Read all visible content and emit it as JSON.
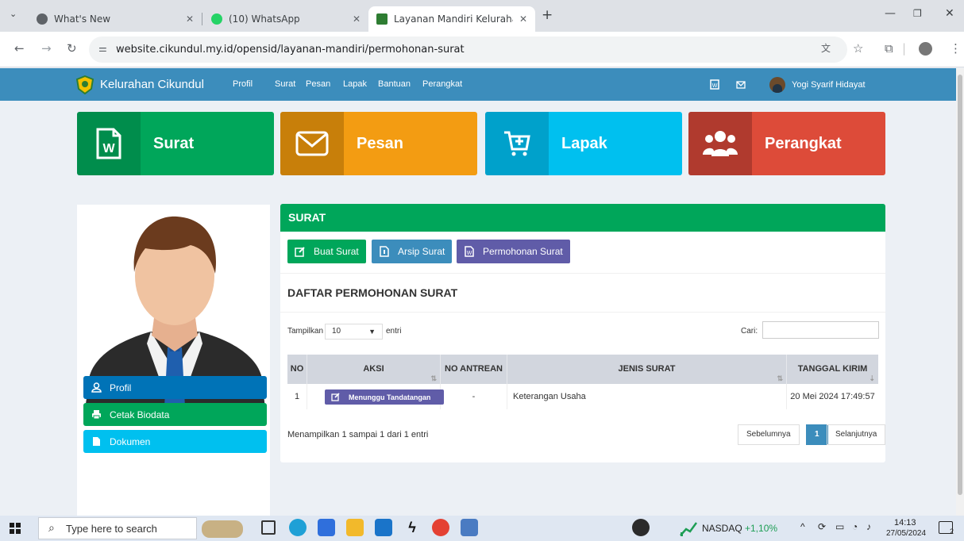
{
  "browser": {
    "tabs": [
      {
        "title": "What's New"
      },
      {
        "title": "(10) WhatsApp"
      },
      {
        "title": "Layanan Mandiri Kelurahan Cik"
      }
    ],
    "url": "website.cikundul.my.id/opensid/layanan-mandiri/permohonan-surat"
  },
  "site": {
    "brand": "Kelurahan Cikundul",
    "nav": [
      "Profil",
      "Surat",
      "Pesan",
      "Lapak",
      "Bantuan",
      "Perangkat"
    ],
    "user": "Yogi Syarif Hidayat"
  },
  "tiles": [
    {
      "label": "Surat",
      "color": "#00a65a",
      "dark": "#008d4c"
    },
    {
      "label": "Pesan",
      "color": "#f39c12",
      "dark": "#c87f0a"
    },
    {
      "label": "Lapak",
      "color": "#00c0ef",
      "dark": "#00a1cb"
    },
    {
      "label": "Perangkat",
      "color": "#dd4b39",
      "dark": "#b03a2e"
    }
  ],
  "sidebar": {
    "buttons": [
      "Profil",
      "Cetak Biodata",
      "Dokumen"
    ]
  },
  "panel": {
    "title": "SURAT",
    "actions": [
      "Buat Surat",
      "Arsip Surat",
      "Permohonan Surat"
    ],
    "subtitle": "DAFTAR PERMOHONAN SURAT",
    "show_label": "Tampilkan",
    "page_size": "10",
    "entries_label": "entri",
    "search_label": "Cari:",
    "search_value": "",
    "columns": [
      "NO",
      "AKSI",
      "NO ANTREAN",
      "JENIS SURAT",
      "TANGGAL KIRIM"
    ],
    "rows": [
      {
        "no": "1",
        "action": "Menunggu Tandatangan",
        "queue": "-",
        "type": "Keterangan Usaha",
        "date": "20 Mei 2024 17:49:57"
      }
    ],
    "info": "Menampilkan 1 sampai 1 dari 1 entri",
    "prev": "Sebelumnya",
    "page": "1",
    "next": "Selanjutnya"
  },
  "taskbar": {
    "search_placeholder": "Type here to search",
    "ticker_name": "NASDAQ",
    "ticker_change": "+1,10%",
    "time": "14:13",
    "date": "27/05/2024",
    "notif_count": "2"
  }
}
